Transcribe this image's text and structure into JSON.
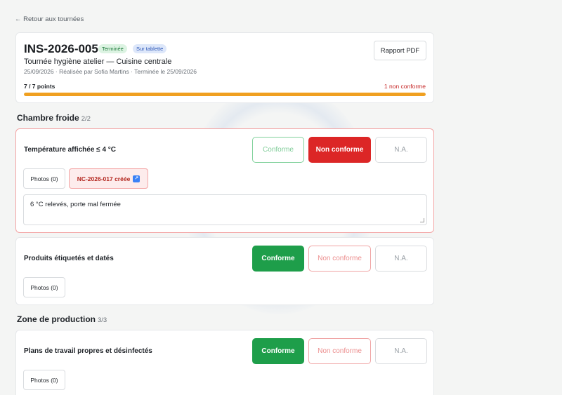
{
  "nav": {
    "back_label": "← Retour aux tournées"
  },
  "inspection": {
    "id": "INS-2026-005",
    "status_badge": "Terminée",
    "device_badge": "Sur tablette",
    "title": "Tournée hygiène atelier — Cuisine centrale",
    "meta": "25/09/2026 · Réalisée par Sofia Martins · Terminée le 25/09/2026",
    "pdf_button": "Rapport PDF",
    "progress_label": "7 / 7 points",
    "progress_fraction": 1.0,
    "nonconform_count": "1 non conforme"
  },
  "choices": {
    "conform": "Conforme",
    "nonconform": "Non conforme",
    "na": "N.A."
  },
  "sections": [
    {
      "title": "Chambre froide",
      "count": "2/2",
      "items": [
        {
          "label": "Température affichée ≤ 4 °C",
          "status": "nonconform",
          "photos": "Photos (0)",
          "nc_link": "NC-2026-017 créée",
          "comment": "6 °C relevés, porte mal fermée"
        },
        {
          "label": "Produits étiquetés et datés",
          "status": "conform",
          "photos": "Photos (0)"
        }
      ]
    },
    {
      "title": "Zone de production",
      "count": "3/3",
      "items": [
        {
          "label": "Plans de travail propres et désinfectés",
          "status": "conform",
          "photos": "Photos (0)"
        }
      ]
    }
  ],
  "colors": {
    "progress": "#f0a020",
    "conform": "#1e9e4a",
    "nonconform": "#dc2626",
    "link_icon": "#3b82f6"
  }
}
